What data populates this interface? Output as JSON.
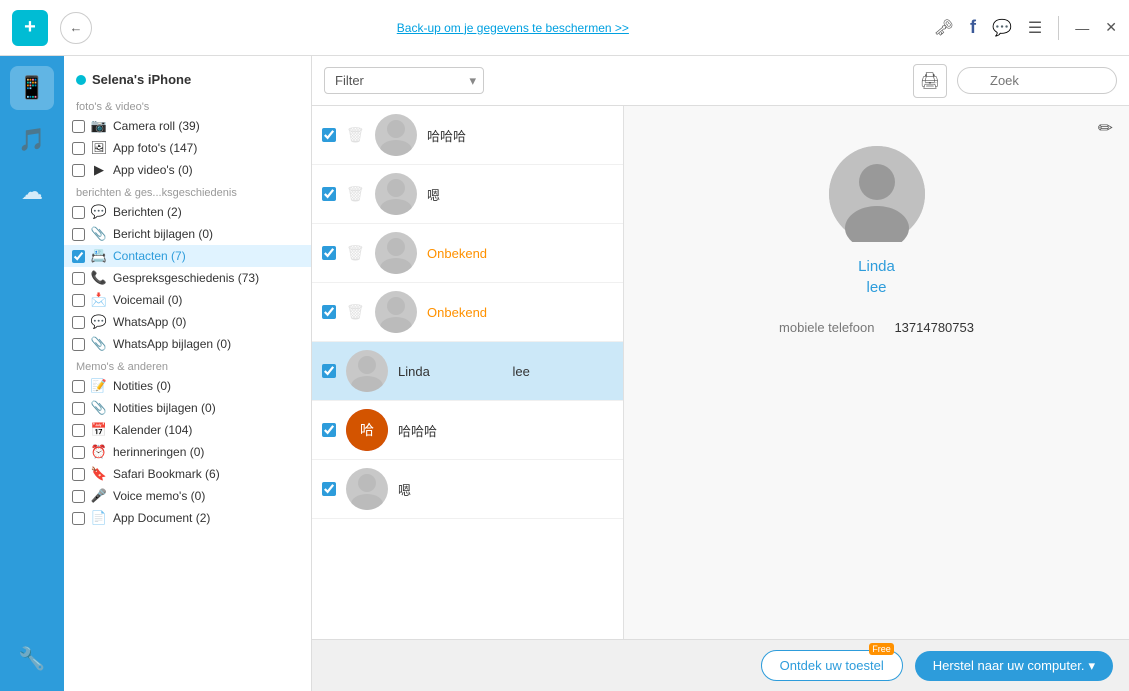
{
  "app": {
    "logo": "+",
    "backup_link": "Back-up om je gegevens te beschermen >>",
    "window_controls": {
      "minimize": "—",
      "close": "✕"
    }
  },
  "nav_icons": [
    {
      "id": "phone-icon",
      "symbol": "📱",
      "active": true
    },
    {
      "id": "music-icon",
      "symbol": "🎵",
      "active": false
    },
    {
      "id": "cloud-icon",
      "symbol": "☁",
      "active": false
    },
    {
      "id": "tools-icon",
      "symbol": "🔧",
      "active": false
    }
  ],
  "device": {
    "name": "Selena's iPhone",
    "indicator_color": "#00bcd4"
  },
  "sections": [
    {
      "label": "foto's & video's",
      "items": [
        {
          "id": "camera-roll",
          "icon": "📷",
          "label": "Camera roll (39)",
          "checked": false
        },
        {
          "id": "app-fotos",
          "icon": "🖼",
          "label": "App foto's (147)",
          "checked": false
        },
        {
          "id": "app-videos",
          "icon": "▶",
          "label": "App video's (0)",
          "checked": false
        }
      ]
    },
    {
      "label": "berichten & ges...ksgeschiedenis",
      "items": [
        {
          "id": "berichten",
          "icon": "💬",
          "label": "Berichten (2)",
          "checked": false
        },
        {
          "id": "bericht-bijlagen",
          "icon": "📎",
          "label": "Bericht bijlagen (0)",
          "checked": false
        },
        {
          "id": "contacten",
          "icon": "📇",
          "label": "Contacten (7)",
          "checked": true,
          "active": true
        },
        {
          "id": "gesprekken",
          "icon": "📞",
          "label": "Gespreksgeschiedenis (73)",
          "checked": false
        },
        {
          "id": "voicemail",
          "icon": "📩",
          "label": "Voicemail (0)",
          "checked": false
        },
        {
          "id": "whatsapp",
          "icon": "💬",
          "label": "WhatsApp (0)",
          "checked": false
        },
        {
          "id": "whatsapp-bijlagen",
          "icon": "📎",
          "label": "WhatsApp bijlagen (0)",
          "checked": false
        }
      ]
    },
    {
      "label": "Memo's & anderen",
      "items": [
        {
          "id": "notities",
          "icon": "📝",
          "label": "Notities (0)",
          "checked": false
        },
        {
          "id": "notities-bijlagen",
          "icon": "📎",
          "label": "Notities bijlagen (0)",
          "checked": false
        },
        {
          "id": "kalender",
          "icon": "📅",
          "label": "Kalender (104)",
          "checked": false
        },
        {
          "id": "herinneringen",
          "icon": "⏰",
          "label": "herinneringen (0)",
          "checked": false
        },
        {
          "id": "safari",
          "icon": "🔖",
          "label": "Safari Bookmark (6)",
          "checked": false
        },
        {
          "id": "voice-memos",
          "icon": "🎤",
          "label": "Voice memo's (0)",
          "checked": false
        },
        {
          "id": "app-document",
          "icon": "📄",
          "label": "App Document (2)",
          "checked": false
        }
      ]
    }
  ],
  "toolbar": {
    "filter_label": "Filter",
    "filter_placeholder": "Filter",
    "search_placeholder": "Zoek"
  },
  "contacts": [
    {
      "id": "c1",
      "name": "哈哈哈",
      "checked": true,
      "has_delete": true,
      "name_color": "normal",
      "avatar_type": "person"
    },
    {
      "id": "c2",
      "name": "嗯",
      "checked": true,
      "has_delete": true,
      "name_color": "normal",
      "avatar_type": "person"
    },
    {
      "id": "c3",
      "name": "Onbekend",
      "checked": true,
      "has_delete": true,
      "name_color": "orange",
      "avatar_type": "person"
    },
    {
      "id": "c4",
      "name": "Onbekend",
      "checked": true,
      "has_delete": true,
      "name_color": "orange",
      "avatar_type": "person"
    },
    {
      "id": "c5",
      "name": "Linda lee",
      "checked": true,
      "has_delete": false,
      "name_color": "normal",
      "avatar_type": "person",
      "selected": true
    },
    {
      "id": "c6",
      "name": "哈哈哈",
      "checked": true,
      "has_delete": false,
      "name_color": "normal",
      "avatar_type": "colored"
    },
    {
      "id": "c7",
      "name": "嗯",
      "checked": true,
      "has_delete": false,
      "name_color": "normal",
      "avatar_type": "person"
    }
  ],
  "detail": {
    "name_line1": "Linda",
    "name_line2": "lee",
    "field_label": "mobiele telefoon",
    "field_value": "13714780753"
  },
  "bottom": {
    "discover_label": "Ontdek uw toestel",
    "discover_badge": "Free",
    "restore_label": "Herstel naar uw computer.",
    "restore_arrow": "▾"
  }
}
